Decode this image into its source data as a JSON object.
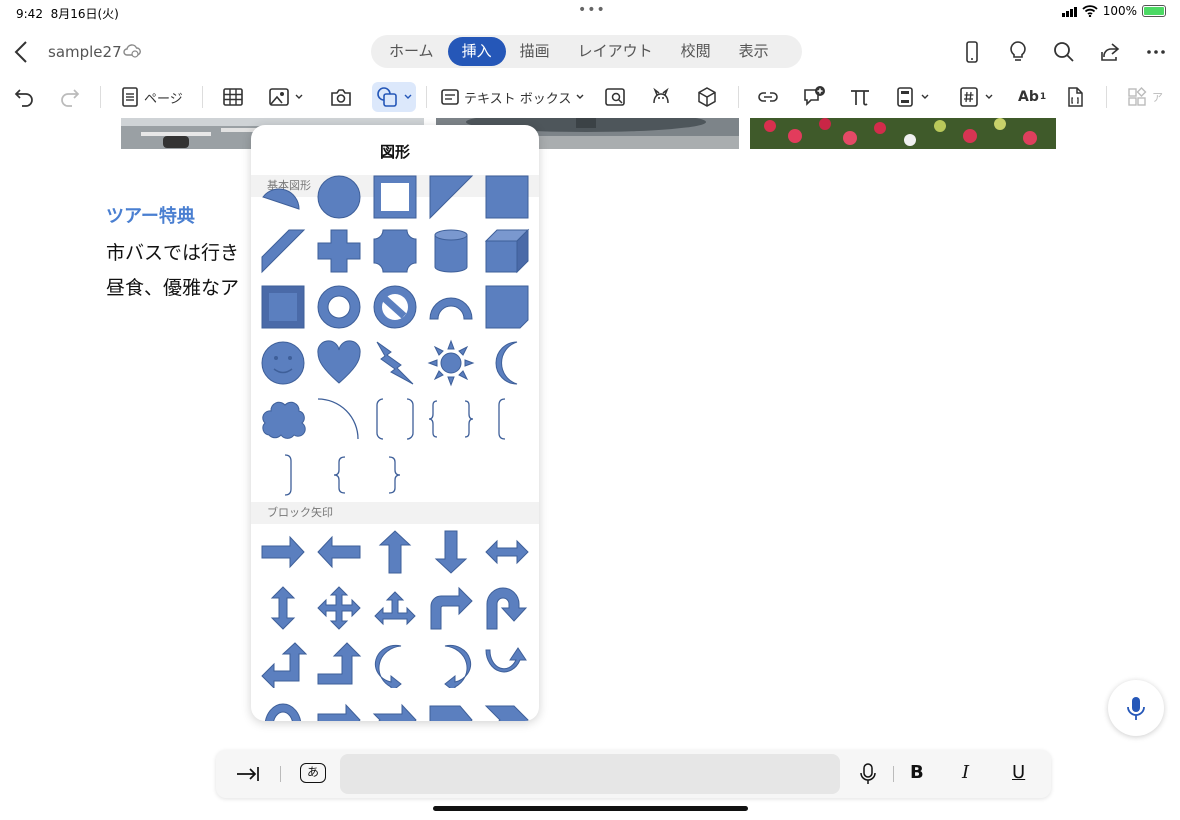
{
  "status": {
    "time": "9:42",
    "date": "8月16日(火)",
    "battery": "100%"
  },
  "doc": {
    "name": "sample27"
  },
  "tabs": [
    {
      "label": "ホーム",
      "active": false
    },
    {
      "label": "挿入",
      "active": true
    },
    {
      "label": "描画",
      "active": false
    },
    {
      "label": "レイアウト",
      "active": false
    },
    {
      "label": "校閲",
      "active": false
    },
    {
      "label": "表示",
      "active": false
    }
  ],
  "toolbar": {
    "page_label": "ページ",
    "textbox_label": "テキスト ボックス",
    "ab_label": "Ab",
    "ab_sup": "1",
    "addin_label": "ア"
  },
  "content": {
    "heading": "ツアー特典",
    "line1": "市バスでは行き",
    "line2": "昼食、優雅なア"
  },
  "shapes_panel": {
    "title": "図形",
    "sections": [
      {
        "label": "基本図形"
      },
      {
        "label": "ブロック矢印"
      }
    ]
  },
  "keyboard_bar": {
    "bold": "B",
    "italic": "I",
    "underline": "U",
    "kana": "あ"
  },
  "colors": {
    "accent": "#2557b8",
    "shape_fill": "#5b7fbf",
    "shape_stroke": "#3e5f99",
    "heading": "#4a7fd1"
  }
}
